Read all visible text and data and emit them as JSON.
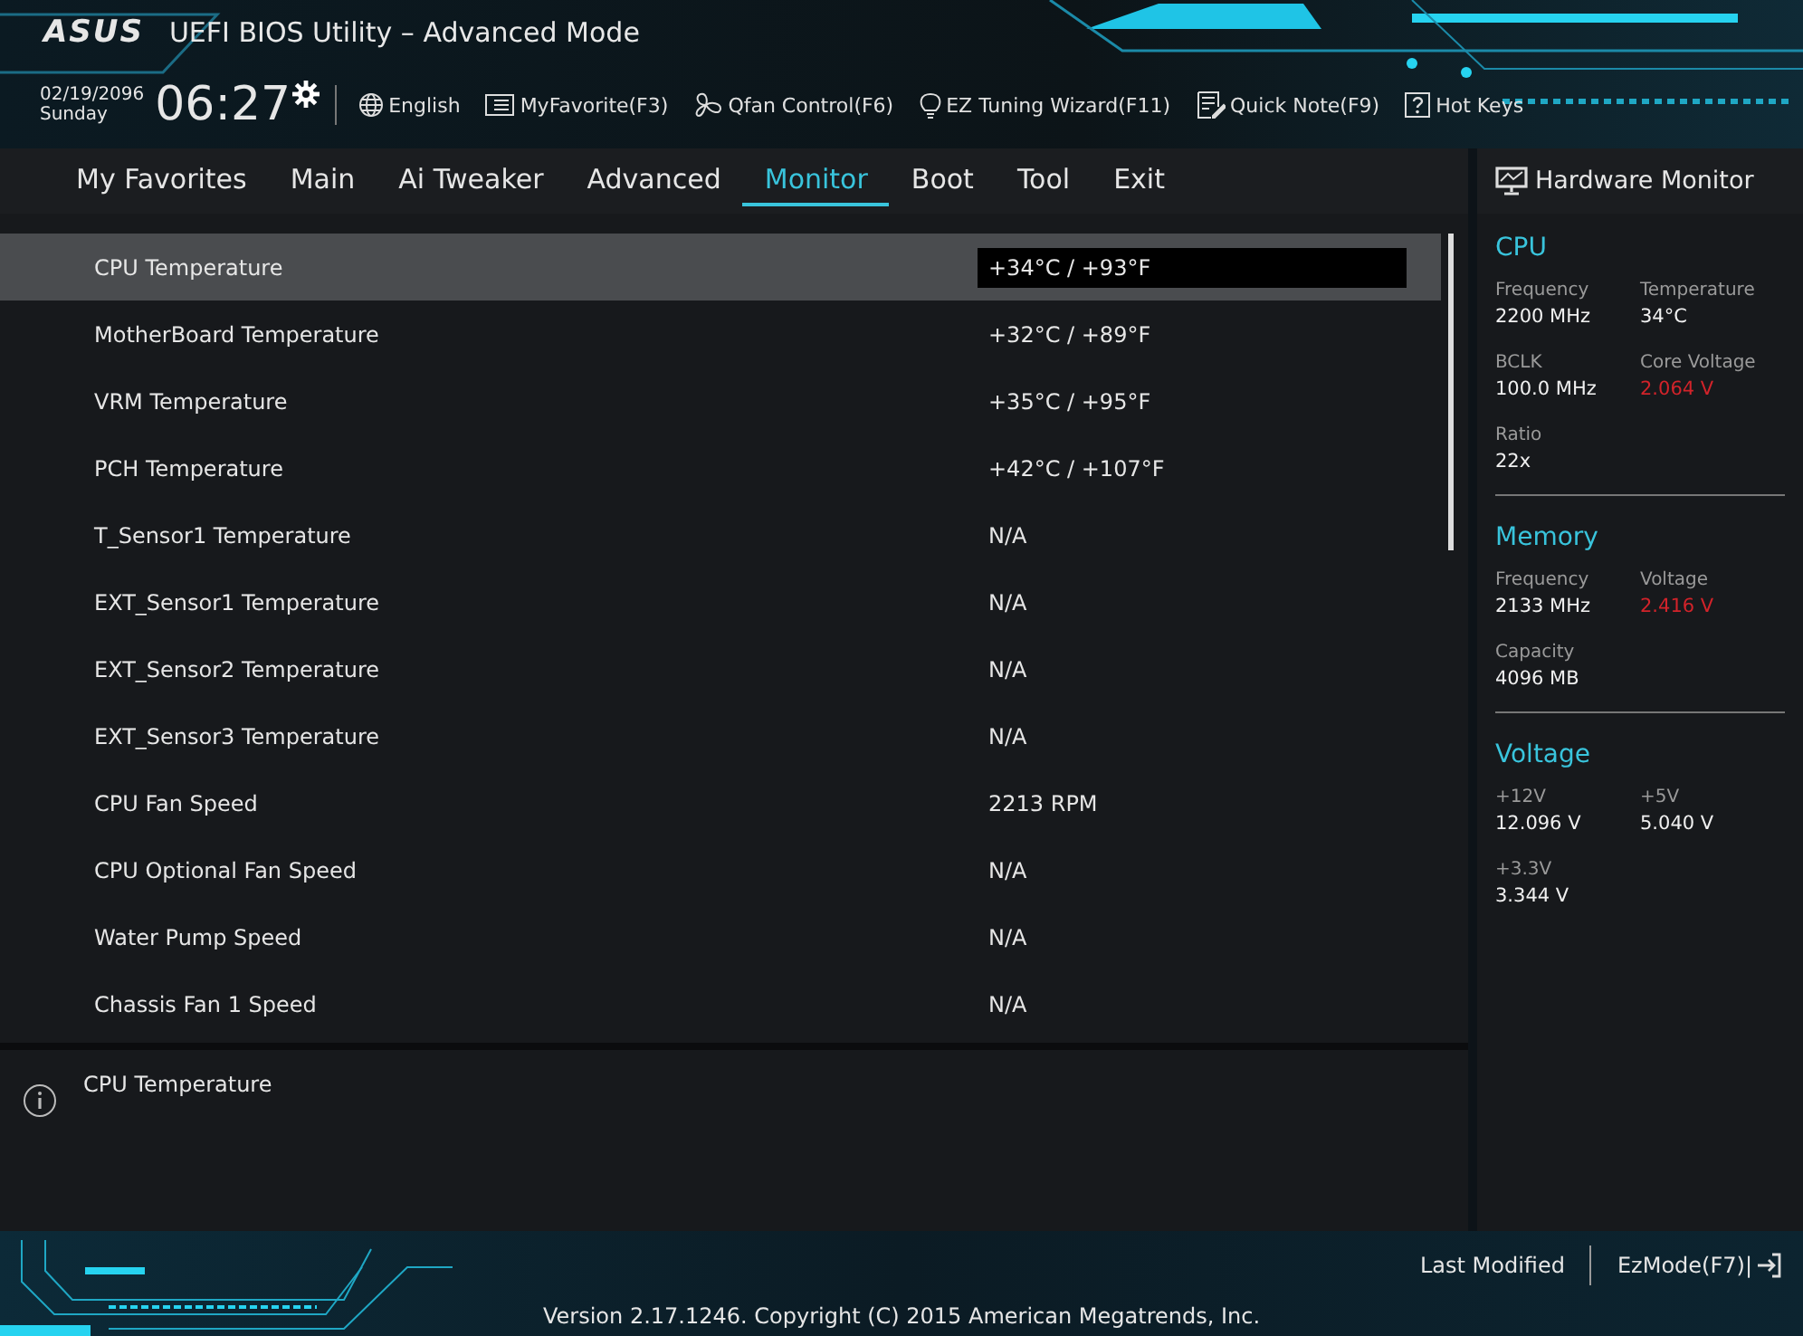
{
  "window": {
    "logo": "ASUS",
    "title": "UEFI BIOS Utility – Advanced Mode"
  },
  "toolbar": {
    "date": "02/19/2096",
    "day": "Sunday",
    "time": "06:27",
    "items": [
      {
        "kind": "globe",
        "label": "English"
      },
      {
        "kind": "list",
        "label": "MyFavorite(F3)"
      },
      {
        "kind": "fan",
        "label": "Qfan Control(F6)"
      },
      {
        "kind": "bulb",
        "label": "EZ Tuning Wizard(F11)"
      },
      {
        "kind": "note",
        "label": "Quick Note(F9)"
      },
      {
        "kind": "help",
        "label": "Hot Keys"
      }
    ]
  },
  "tabs": [
    {
      "label": "My Favorites",
      "selected": false
    },
    {
      "label": "Main",
      "selected": false
    },
    {
      "label": "Ai Tweaker",
      "selected": false
    },
    {
      "label": "Advanced",
      "selected": false
    },
    {
      "label": "Monitor",
      "selected": true
    },
    {
      "label": "Boot",
      "selected": false
    },
    {
      "label": "Tool",
      "selected": false
    },
    {
      "label": "Exit",
      "selected": false
    }
  ],
  "rows": [
    {
      "label": "CPU Temperature",
      "value": "+34°C / +93°F",
      "selected": true
    },
    {
      "label": "MotherBoard Temperature",
      "value": "+32°C / +89°F",
      "selected": false
    },
    {
      "label": "VRM Temperature",
      "value": "+35°C / +95°F",
      "selected": false
    },
    {
      "label": "PCH Temperature",
      "value": "+42°C / +107°F",
      "selected": false
    },
    {
      "label": "T_Sensor1 Temperature",
      "value": "N/A",
      "selected": false
    },
    {
      "label": "EXT_Sensor1  Temperature",
      "value": "N/A",
      "selected": false
    },
    {
      "label": "EXT_Sensor2  Temperature",
      "value": "N/A",
      "selected": false
    },
    {
      "label": "EXT_Sensor3  Temperature",
      "value": "N/A",
      "selected": false
    },
    {
      "label": "CPU Fan Speed",
      "value": "2213 RPM",
      "selected": false
    },
    {
      "label": "CPU Optional Fan Speed",
      "value": "N/A",
      "selected": false
    },
    {
      "label": "Water Pump Speed",
      "value": "N/A",
      "selected": false
    },
    {
      "label": "Chassis Fan 1 Speed",
      "value": "N/A",
      "selected": false
    }
  ],
  "help": {
    "text": "CPU Temperature"
  },
  "hardware_monitor": {
    "title": "Hardware Monitor",
    "sections": [
      {
        "title": "CPU",
        "items": [
          {
            "label": "Frequency",
            "value": "2200 MHz",
            "alert": false
          },
          {
            "label": "Temperature",
            "value": "34°C",
            "alert": false
          },
          {
            "label": "BCLK",
            "value": "100.0 MHz",
            "alert": false
          },
          {
            "label": "Core Voltage",
            "value": "2.064 V",
            "alert": true
          },
          {
            "label": "Ratio",
            "value": "22x",
            "alert": false
          }
        ]
      },
      {
        "title": "Memory",
        "items": [
          {
            "label": "Frequency",
            "value": "2133 MHz",
            "alert": false
          },
          {
            "label": "Voltage",
            "value": "2.416 V",
            "alert": true
          },
          {
            "label": "Capacity",
            "value": "4096 MB",
            "alert": false
          }
        ]
      },
      {
        "title": "Voltage",
        "items": [
          {
            "label": "+12V",
            "value": "12.096 V",
            "alert": false
          },
          {
            "label": "+5V",
            "value": "5.040 V",
            "alert": false
          },
          {
            "label": "+3.3V",
            "value": "3.344 V",
            "alert": false
          }
        ]
      }
    ]
  },
  "footer": {
    "version": "Version 2.17.1246. Copyright (C) 2015 American Megatrends, Inc.",
    "last_modified": "Last Modified",
    "ez_mode": "EzMode(F7)|"
  }
}
